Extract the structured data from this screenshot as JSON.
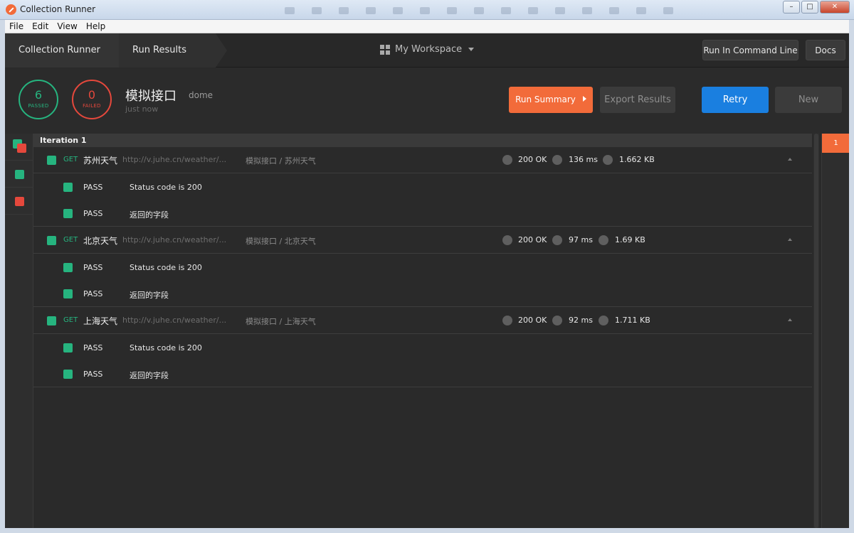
{
  "window": {
    "title": "Collection Runner",
    "menu": [
      "File",
      "Edit",
      "View",
      "Help"
    ]
  },
  "header": {
    "breadcrumb": [
      "Collection Runner",
      "Run Results"
    ],
    "workspace": "My Workspace",
    "run_cli_label": "Run In Command Line",
    "docs_label": "Docs"
  },
  "summary": {
    "passed": {
      "count": "6",
      "label": "PASSED"
    },
    "failed": {
      "count": "0",
      "label": "FAILED"
    },
    "title": "模拟接口",
    "environment": "dome",
    "time": "just now",
    "run_summary_label": "Run Summary",
    "export_label": "Export Results",
    "retry_label": "Retry",
    "new_label": "New"
  },
  "iteration": {
    "label": "Iteration 1",
    "badge": "1"
  },
  "requests": [
    {
      "method": "GET",
      "name": "苏州天气",
      "url": "http://v.juhe.cn/weather/...",
      "path": "模拟接口 / 苏州天气",
      "status": "200 OK",
      "time": "136 ms",
      "size": "1.662 KB",
      "tests": [
        {
          "result": "PASS",
          "name": "Status code is 200"
        },
        {
          "result": "PASS",
          "name": "返回的字段"
        }
      ]
    },
    {
      "method": "GET",
      "name": "北京天气",
      "url": "http://v.juhe.cn/weather/...",
      "path": "模拟接口 / 北京天气",
      "status": "200 OK",
      "time": "97 ms",
      "size": "1.69 KB",
      "tests": [
        {
          "result": "PASS",
          "name": "Status code is 200"
        },
        {
          "result": "PASS",
          "name": "返回的字段"
        }
      ]
    },
    {
      "method": "GET",
      "name": "上海天气",
      "url": "http://v.juhe.cn/weather/...",
      "path": "模拟接口 / 上海天气",
      "status": "200 OK",
      "time": "92 ms",
      "size": "1.711 KB",
      "tests": [
        {
          "result": "PASS",
          "name": "Status code is 200"
        },
        {
          "result": "PASS",
          "name": "返回的字段"
        }
      ]
    }
  ],
  "colors": {
    "pass": "#26b47f",
    "fail": "#e5483c",
    "accent_orange": "#f26b3a",
    "accent_blue": "#1a7fe0"
  }
}
